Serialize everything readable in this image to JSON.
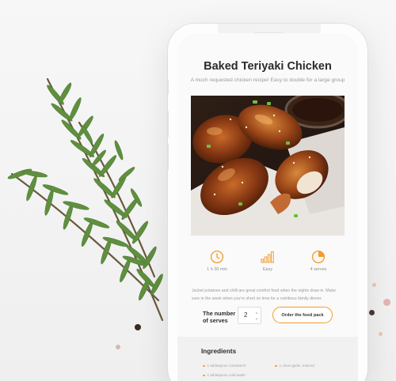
{
  "recipe": {
    "title": "Baked Teriyaki Chicken",
    "subtitle": "A much requested chicken recipe! Easy to double for a large group",
    "image_alt": "baked teriyaki chicken drumsticks"
  },
  "stats": [
    {
      "icon": "clock-icon",
      "label": "1 h 30 min"
    },
    {
      "icon": "difficulty-bars-icon",
      "label": "Easy"
    },
    {
      "icon": "servings-pie-icon",
      "label": "4 serves"
    }
  ],
  "description": "Jacket potatoes and chilli are great comfort food when the nights draw in. Make sure in the week when you're short on time for a nutritious family dinner.",
  "order": {
    "serves_label": "The number of serves",
    "serves_value": "2",
    "button_label": "Order the food pack"
  },
  "ingredients": {
    "title": "Ingredients",
    "items": [
      "1 tablespoon cornstarch",
      "1 clove garlic, minced",
      "1 tablespoon cold water"
    ]
  },
  "colors": {
    "accent": "#f39b2c",
    "title": "#2b2b2b",
    "muted": "#9b9b9b"
  }
}
